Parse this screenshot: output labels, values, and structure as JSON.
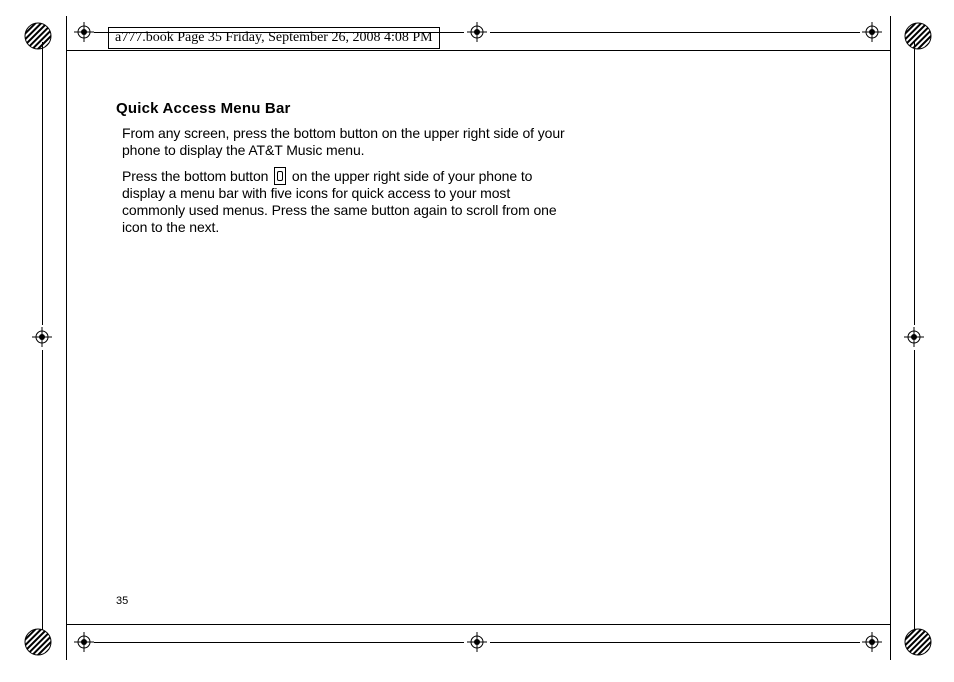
{
  "header": {
    "text": "a777.book  Page 35  Friday, September 26, 2008  4:08 PM"
  },
  "body": {
    "heading": "Quick Access Menu Bar",
    "para1": "From any screen, press the bottom button on the upper right side of your phone to display the AT&T Music menu.",
    "para2_a": "Press the bottom button ",
    "para2_b": " on the upper right side of your phone to display a menu bar with five icons for quick access to your most commonly used menus. Press the same button again to scroll from one icon to the next."
  },
  "page_number": "35"
}
